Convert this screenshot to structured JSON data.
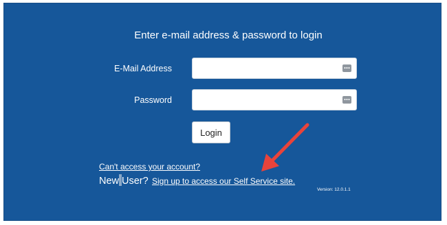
{
  "login": {
    "heading": "Enter e-mail address & password to login",
    "email_label": "E-Mail Address",
    "email_value": "",
    "password_label": "Password",
    "password_value": "",
    "login_button": "Login"
  },
  "links": {
    "cant_access": "Can't access your account?",
    "new_user_prefix_1": "New",
    "new_user_prefix_2": "User?",
    "signup": "Sign up to access our Self Service site."
  },
  "footer": {
    "version": "Version: 12.0.1.1"
  },
  "icons": {
    "field_icon": "password-manager-key-icon",
    "annotation": "red-arrow"
  },
  "colors": {
    "background": "#16579a",
    "arrow": "#e8433b"
  }
}
